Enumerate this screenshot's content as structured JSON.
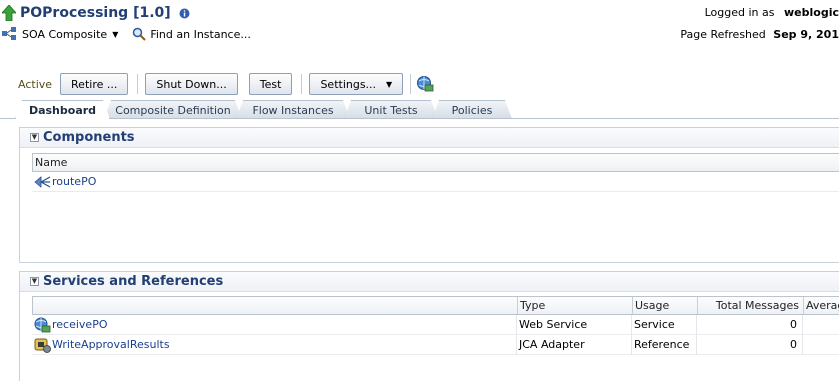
{
  "header": {
    "title": "POProcessing [1.0]",
    "logged_in_label": "Logged in as",
    "user": "weblogic",
    "nav": {
      "soa_composite": "SOA Composite",
      "find_instance": "Find an Instance..."
    },
    "refreshed_label": "Page Refreshed",
    "refreshed_value": "Sep 9, 201"
  },
  "toolbar": {
    "status": "Active",
    "retire": "Retire ...",
    "shutdown": "Shut Down...",
    "test": "Test",
    "settings": "Settings..."
  },
  "tabs": [
    {
      "label": "Dashboard",
      "selected": true
    },
    {
      "label": "Composite Definition"
    },
    {
      "label": "Flow Instances"
    },
    {
      "label": "Unit Tests"
    },
    {
      "label": "Policies"
    }
  ],
  "components": {
    "title": "Components",
    "columns": [
      "Name"
    ],
    "rows": [
      {
        "name": "routePO",
        "icon": "mediator-icon"
      }
    ]
  },
  "services": {
    "title": "Services and References",
    "columns": [
      "",
      "Type",
      "Usage",
      "Total Messages",
      "Averag"
    ],
    "rows": [
      {
        "name": "receivePO",
        "type": "Web Service",
        "usage": "Service",
        "total": "0",
        "icon": "web-service-icon"
      },
      {
        "name": "WriteApprovalResults",
        "type": "JCA Adapter",
        "usage": "Reference",
        "total": "0",
        "icon": "jca-adapter-icon"
      }
    ]
  },
  "colors": {
    "title": "#213F75",
    "link": "#1a3f8f",
    "border": "#b9c4cf"
  }
}
